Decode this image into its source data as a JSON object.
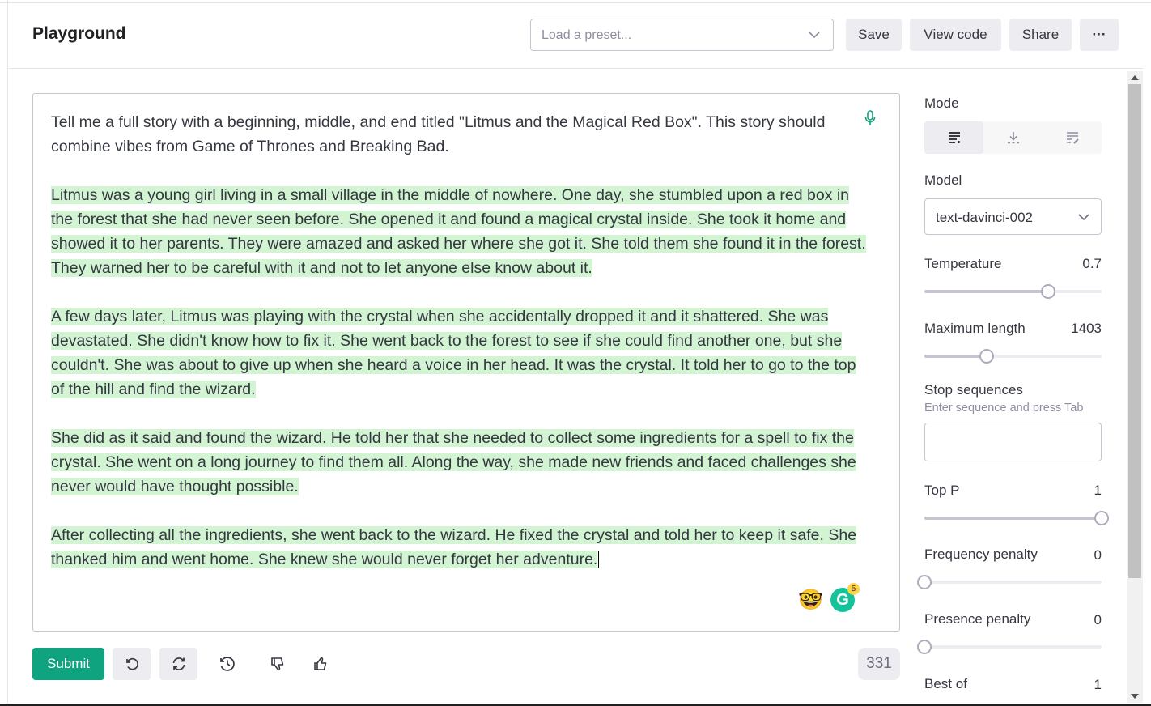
{
  "header": {
    "title": "Playground",
    "preset_placeholder": "Load a preset...",
    "save_label": "Save",
    "view_code_label": "View code",
    "share_label": "Share",
    "more_label": "···"
  },
  "editor": {
    "prompt": "Tell me a full story with a beginning, middle, and end titled \"Litmus and the Magical Red Box\". This story should combine vibes from Game of Thrones and Breaking Bad.",
    "completion": [
      "Litmus was a young girl living in a small village in the middle of nowhere. One day, she stumbled upon a red box in the forest that she had never seen before. She opened it and found a magical crystal inside. She took it home and showed it to her parents. They were amazed and asked her where she got it. She told them she found it in the forest. They warned her to be careful with it and not to let anyone else know about it.",
      "A few days later, Litmus was playing with the crystal when she accidentally dropped it and it shattered. She was devastated. She didn't know how to fix it. She went back to the forest to see if she could find another one, but she couldn't. She was about to give up when she heard a voice in her head. It was the crystal. It told  her to go to the top of the hill and find the wizard.",
      "She did as it said and found the wizard. He told her that she needed to collect some ingredients for a spell to fix the crystal. She went on a long journey to find them all. Along the way, she made new friends and faced challenges she never would have thought possible.",
      "After collecting all the ingredients, she went back to the wizard. He fixed the crystal and told her to keep it safe. She thanked him and went home. She knew she would never forget her adventure."
    ],
    "grammarly_badge": "5",
    "grammarly_letter": "G",
    "emoji": "🤓"
  },
  "footer": {
    "submit_label": "Submit",
    "token_count": "331"
  },
  "settings": {
    "mode_label": "Mode",
    "model_label": "Model",
    "model_value": "text-davinci-002",
    "temperature": {
      "label": "Temperature",
      "value": "0.7",
      "fraction": 0.7
    },
    "max_length": {
      "label": "Maximum length",
      "value": "1403",
      "fraction": 0.35
    },
    "stop_label": "Stop sequences",
    "stop_hint": "Enter sequence and press Tab",
    "top_p": {
      "label": "Top P",
      "value": "1",
      "fraction": 1.0
    },
    "frequency_penalty": {
      "label": "Frequency penalty",
      "value": "0",
      "fraction": 0.0
    },
    "presence_penalty": {
      "label": "Presence penalty",
      "value": "0",
      "fraction": 0.0
    },
    "best_of": {
      "label": "Best of",
      "value": "1"
    }
  }
}
